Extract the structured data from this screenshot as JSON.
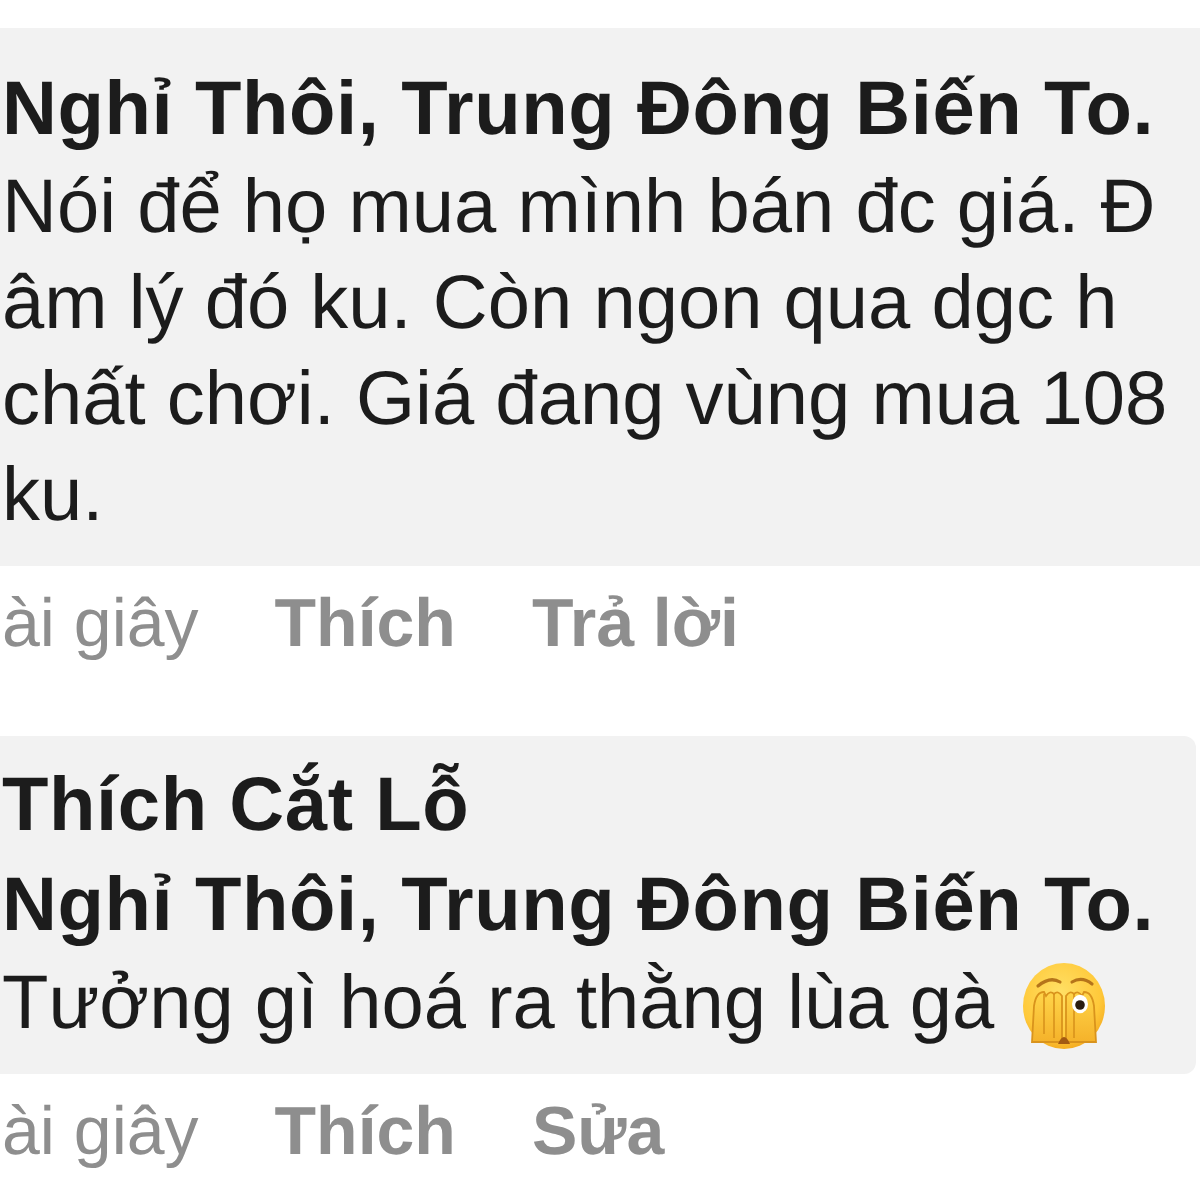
{
  "comments": [
    {
      "author": "Nghỉ Thôi, Trung Đông Biến To.",
      "lines": [
        "Nói để họ mua mình bán đc giá. Đ",
        "âm lý đó ku. Còn ngon qua dgc h",
        "chất chơi. Giá đang vùng mua 108",
        "ku."
      ],
      "time": "ài giây",
      "actions": [
        "Thích",
        "Trả lời"
      ]
    },
    {
      "author": "Thích Cắt Lỗ",
      "mention": "Nghỉ Thôi, Trung Đông Biến To.",
      "lines": [
        "Tưởng gì hoá ra thằng lùa gà"
      ],
      "emoji": true,
      "time": "ài giây",
      "actions": [
        "Thích",
        "Sửa"
      ]
    }
  ]
}
